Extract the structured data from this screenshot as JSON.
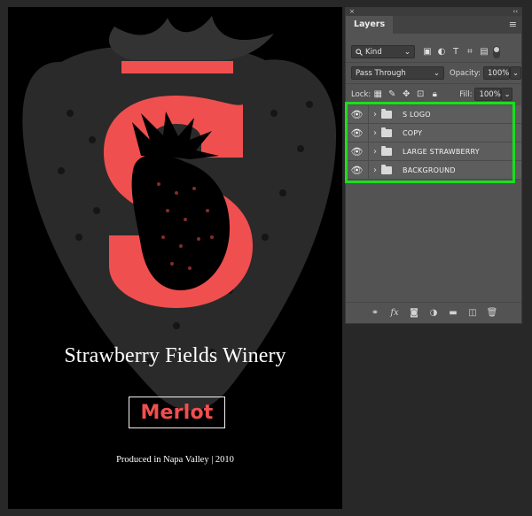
{
  "canvas": {
    "title": "Strawberry Fields Winery",
    "wine": "Merlot",
    "produced": "Produced in Napa Valley | 2010",
    "colors": {
      "accent": "#f04f4f",
      "background": "#000000",
      "strawberry_shadow": "#2a2a2a"
    }
  },
  "panel": {
    "top_left": "×",
    "top_right": "‹‹",
    "tab": "Layers",
    "menu_icon": "≡",
    "filter": {
      "icon": "search-icon",
      "label": "Kind"
    },
    "blend": {
      "mode": "Pass Through",
      "opacity_label": "Opacity:",
      "opacity": "100%"
    },
    "lock": {
      "label": "Lock:",
      "fill_label": "Fill:",
      "fill": "100%"
    },
    "layers": [
      {
        "name": "S LOGO"
      },
      {
        "name": "COPY"
      },
      {
        "name": "LARGE STRAWBERRY"
      },
      {
        "name": "BACKGROUND"
      }
    ],
    "highlight_color": "#19e01c",
    "bottom_icons": [
      "link-icon",
      "fx-icon",
      "mask-icon",
      "adjustment-icon",
      "group-icon",
      "new-layer-icon",
      "trash-icon"
    ]
  }
}
